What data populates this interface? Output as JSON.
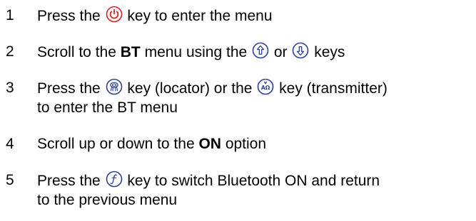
{
  "steps": [
    {
      "number": "1",
      "parts": {
        "a": "Press the",
        "icon1": "power-icon",
        "b": "key to enter the menu"
      }
    },
    {
      "number": "2",
      "parts": {
        "a": "Scroll to the",
        "bold": "BT",
        "b": "menu using the",
        "icon1": "up-arrow-icon",
        "c": "or",
        "icon2": "down-arrow-icon",
        "d": "keys"
      }
    },
    {
      "number": "3",
      "parts": {
        "a": "Press the",
        "icon1": "locator-antenna-icon",
        "b": "key (locator) or the",
        "icon2": "transmitter-icon",
        "c": "key (transmitter)",
        "line2": "to enter the BT menu"
      }
    },
    {
      "number": "4",
      "parts": {
        "a": "Scroll up or down to the",
        "bold": "ON",
        "b": "option"
      }
    },
    {
      "number": "5",
      "parts": {
        "a": "Press the",
        "icon1": "function-icon",
        "b": "key to switch Bluetooth ON and return",
        "line2": "to the previous menu"
      }
    }
  ],
  "icon_glyphs": {
    "transmitter": "AΩ"
  },
  "colors": {
    "icon_red": "#e02020",
    "icon_blue": "#2a3ea0",
    "text": "#000000"
  }
}
